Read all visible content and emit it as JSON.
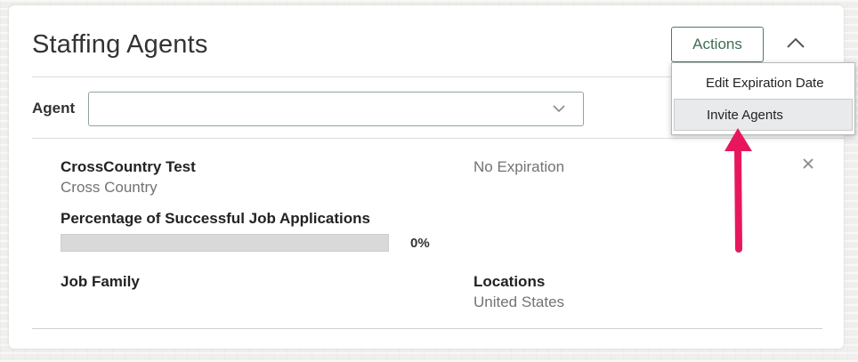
{
  "panel": {
    "title": "Staffing Agents",
    "actions_label": "Actions",
    "collapse_icon": "chevron-up-icon"
  },
  "agent_filter": {
    "label": "Agent",
    "value": "",
    "dropdown_icon": "chevron-down-icon"
  },
  "agent_card": {
    "name": "CrossCountry Test",
    "company": "Cross Country",
    "expiration": "No Expiration",
    "success_label": "Percentage of Successful Job Applications",
    "success_percent": 0,
    "success_percent_text": "0%",
    "job_family_label": "Job Family",
    "job_family_value": "",
    "locations_label": "Locations",
    "locations_value": "United States",
    "remove_icon": "close-icon"
  },
  "actions_menu": {
    "items": [
      {
        "label": "Edit Expiration Date"
      },
      {
        "label": "Invite Agents",
        "hovered": true
      }
    ]
  },
  "annotation": {
    "arrow_color": "#e8175d",
    "arrow_icon": "arrow-up-icon"
  },
  "colors": {
    "accent": "#4d7c65",
    "progress_track": "#d9d9d9"
  }
}
